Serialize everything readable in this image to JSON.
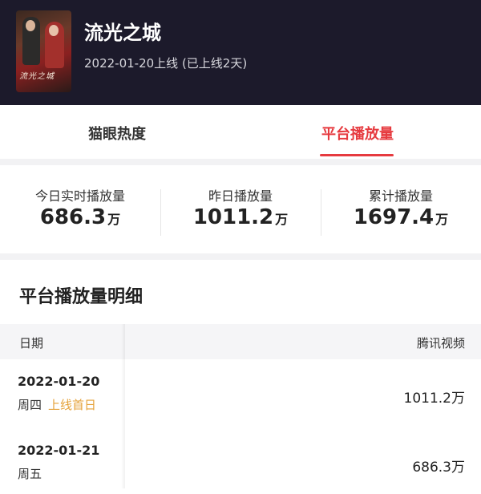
{
  "show": {
    "title": "流光之城",
    "poster_text": "流光之城",
    "release_text": "2022-01-20上线 (已上线2天)"
  },
  "tabs": [
    {
      "label": "猫眼热度",
      "active": false
    },
    {
      "label": "平台播放量",
      "active": true
    }
  ],
  "accent_color": "#e63a3f",
  "stats": [
    {
      "label": "今日实时播放量",
      "value": "686.3",
      "unit": "万"
    },
    {
      "label": "昨日播放量",
      "value": "1011.2",
      "unit": "万"
    },
    {
      "label": "累计播放量",
      "value": "1697.4",
      "unit": "万"
    }
  ],
  "detail": {
    "title": "平台播放量明细",
    "columns": {
      "date": "日期",
      "platform": "腾讯视频"
    },
    "rows": [
      {
        "date": "2022-01-20",
        "weekday": "周四",
        "badge": "上线首日",
        "value": "1011.2万"
      },
      {
        "date": "2022-01-21",
        "weekday": "周五",
        "badge": "",
        "value": "686.3万"
      }
    ]
  }
}
